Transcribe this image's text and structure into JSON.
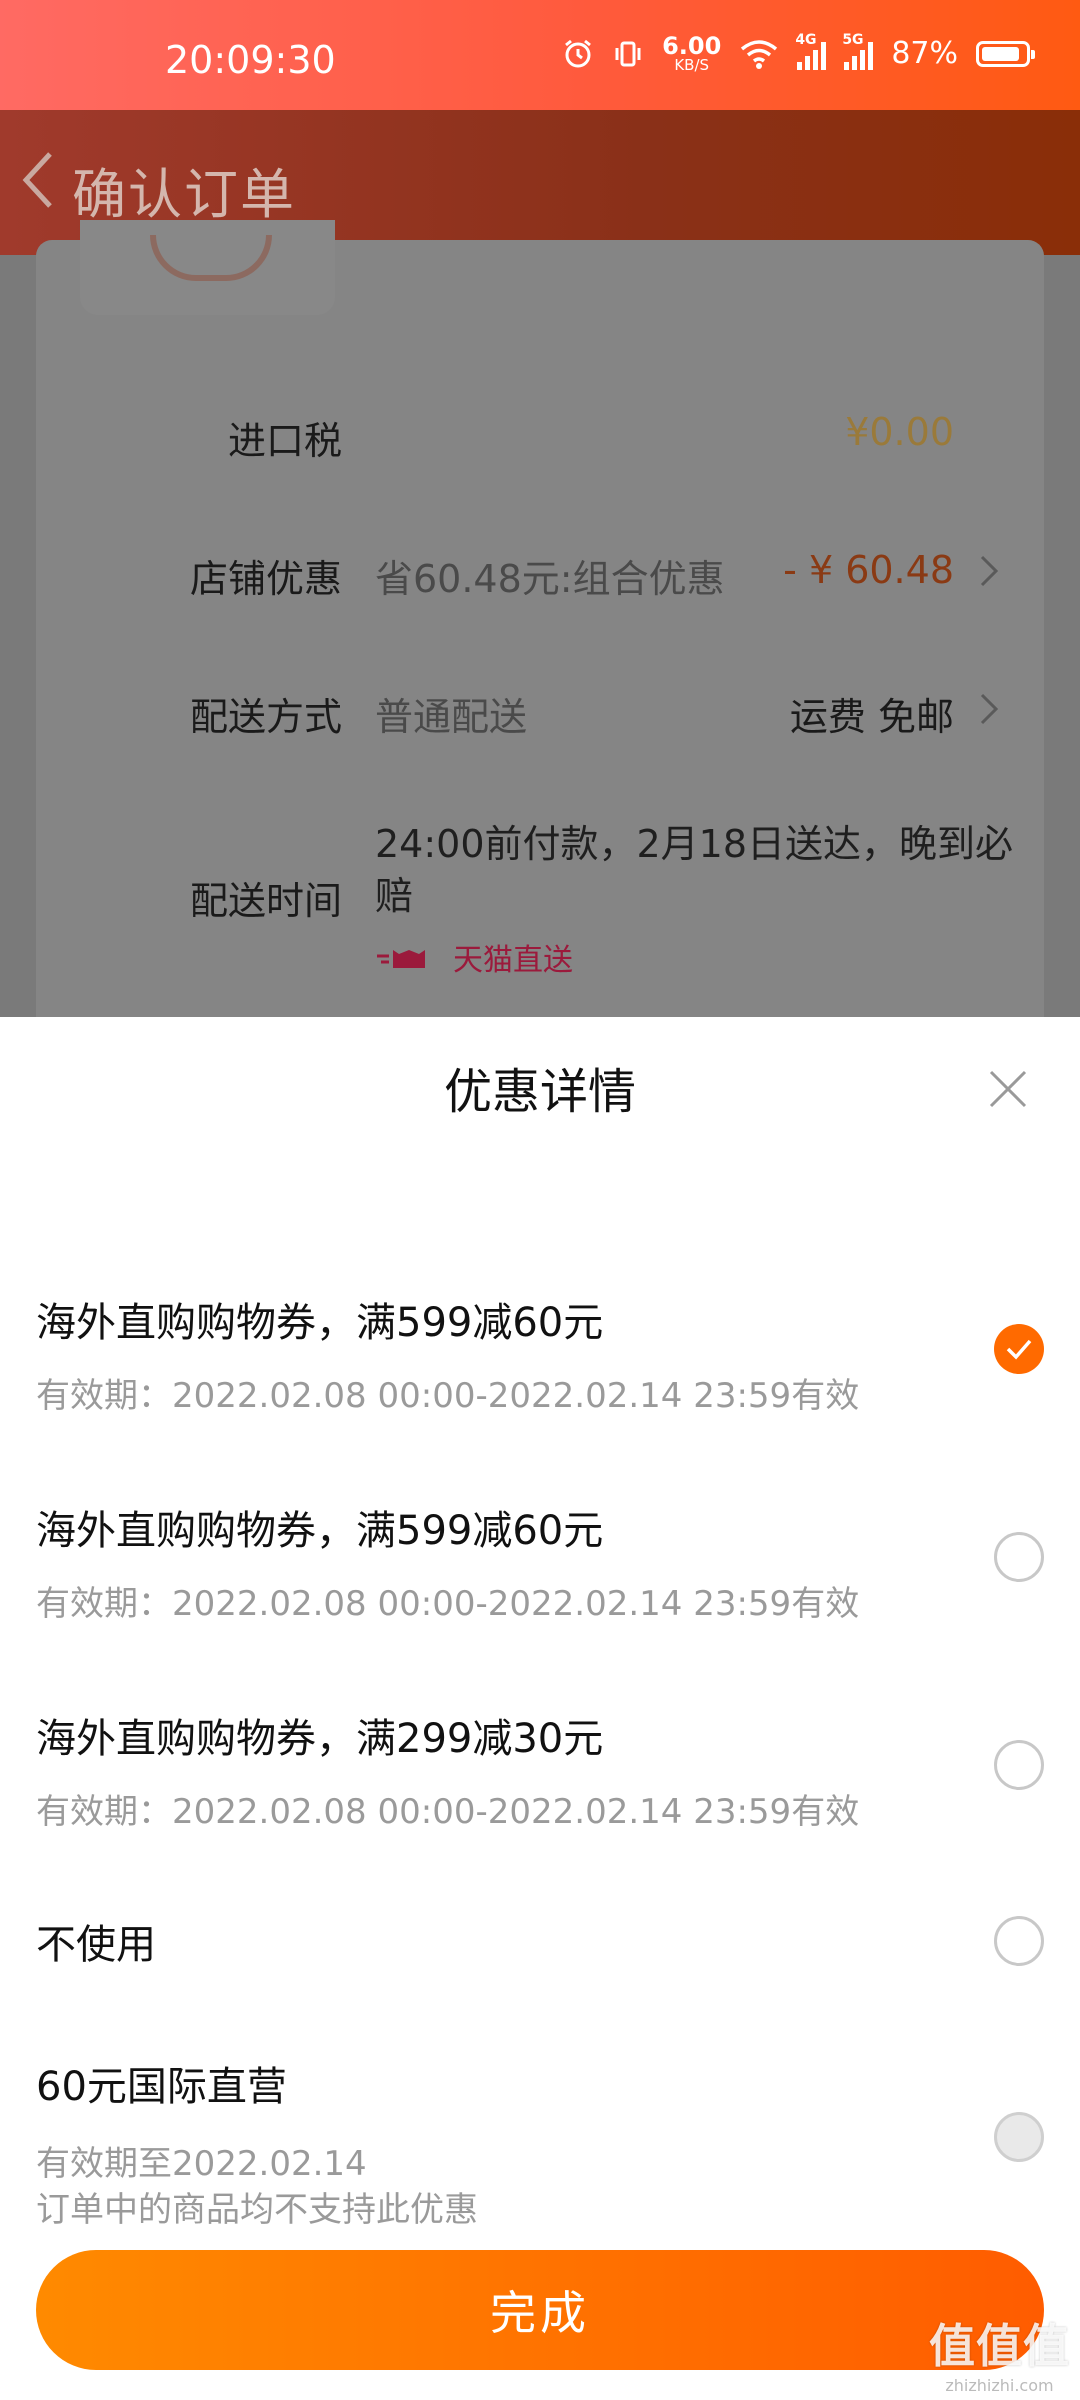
{
  "status_bar": {
    "time": "20:09:30",
    "net_speed_value": "6.00",
    "net_speed_unit": "KB/S",
    "signal1_label": "4G",
    "signal2_label": "5G",
    "battery": "87%",
    "battery_level": 0.87
  },
  "header": {
    "title": "确认订单"
  },
  "order": {
    "tax": {
      "label": "进口税",
      "value": "¥0.00"
    },
    "shop_discount": {
      "label": "店铺优惠",
      "detail": "省60.48元:组合优惠",
      "value": "- ¥ 60.48"
    },
    "shipping": {
      "label": "配送方式",
      "detail": "普通配送",
      "value": "运费 免邮"
    },
    "delivery_time": {
      "label": "配送时间",
      "detail": "24:00前付款，2月18日送达，晚到必赔",
      "badge": "天猫直送"
    }
  },
  "sheet": {
    "title": "优惠详情",
    "options": [
      {
        "title": "海外直购购物券，满599减60元",
        "subtitle": "有效期：2022.02.08 00:00-2022.02.14 23:59有效",
        "selected": true
      },
      {
        "title": "海外直购购物券，满599减60元",
        "subtitle": "有效期：2022.02.08 00:00-2022.02.14 23:59有效",
        "selected": false
      },
      {
        "title": "海外直购购物券，满299减30元",
        "subtitle": "有效期：2022.02.08 00:00-2022.02.14 23:59有效",
        "selected": false
      },
      {
        "title": "不使用",
        "selected": false
      },
      {
        "title": "60元国际直营",
        "subtitle": "有效期至2022.02.14",
        "note": "订单中的商品均不支持此优惠",
        "disabled": true
      }
    ],
    "done_label": "完成"
  },
  "watermark": {
    "logo": "值值值",
    "site": "zhizhizhi.com"
  },
  "colors": {
    "accent": "#ff6a00",
    "price_orange": "#ff5a12",
    "tmall_red": "#9b1a3c"
  }
}
